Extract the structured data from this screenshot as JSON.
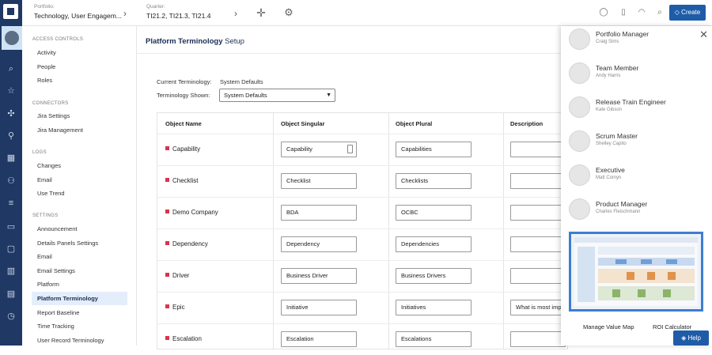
{
  "topbar": {
    "portfolio_label": "Portfolio:",
    "portfolio_value": "Technology, User Engagem...",
    "quarter_label": "Quarter:",
    "quarter_value": "TI21.2, TI21.3, TI21.4",
    "create_label": "Create"
  },
  "sidebar": {
    "sections": [
      {
        "heading": "ACCESS CONTROLS",
        "items": [
          "Activity",
          "People",
          "Roles"
        ]
      },
      {
        "heading": "CONNECTORS",
        "items": [
          "Jira Settings",
          "Jira Management"
        ]
      },
      {
        "heading": "LOGS",
        "items": [
          "Changes",
          "Email",
          "Use Trend"
        ]
      },
      {
        "heading": "SETTINGS",
        "items": [
          "Announcement",
          "Details Panels Settings",
          "Email",
          "Email Settings",
          "Platform",
          "Platform Terminology",
          "Report Baseline",
          "Time Tracking",
          "User Record Terminology"
        ]
      }
    ],
    "active": "Platform Terminology"
  },
  "page": {
    "title_bold": "Platform Terminology",
    "title_rest": " Setup",
    "current_label": "Current Terminology:",
    "current_value": "System Defaults",
    "shown_label": "Terminology Shown:",
    "shown_value": "System Defaults"
  },
  "table": {
    "headers": [
      "Object Name",
      "Object Singular",
      "Object Plural",
      "Description"
    ],
    "rows": [
      {
        "name": "Capability",
        "singular": "Capability",
        "plural": "Capabilities",
        "description": ""
      },
      {
        "name": "Checklist",
        "singular": "Checklist",
        "plural": "Checklists",
        "description": ""
      },
      {
        "name": "Demo Company",
        "singular": "BDA",
        "plural": "OCBC",
        "description": ""
      },
      {
        "name": "Dependency",
        "singular": "Dependency",
        "plural": "Dependencies",
        "description": ""
      },
      {
        "name": "Driver",
        "singular": "Business Driver",
        "plural": "Business Drivers",
        "description": ""
      },
      {
        "name": "Epic",
        "singular": "Initiative",
        "plural": "Initiatives",
        "description": "What is most imp"
      },
      {
        "name": "Escalation",
        "singular": "Escalation",
        "plural": "Escalations",
        "description": ""
      }
    ]
  },
  "panel": {
    "people": [
      {
        "role": "Portfolio Manager",
        "name": "Craig Sims"
      },
      {
        "role": "Team Member",
        "name": "Andy Harris"
      },
      {
        "role": "Release Train Engineer",
        "name": "Kate Gibson"
      },
      {
        "role": "Scrum Master",
        "name": "Shelley Capito"
      },
      {
        "role": "Executive",
        "name": "Matt Comyn"
      },
      {
        "role": "Product Manager",
        "name": "Charles Fleischmann"
      }
    ],
    "manage_label": "Manage Value Map",
    "roi_label": "ROI Calculator"
  },
  "help_label": "Help",
  "colors": {
    "rail": "#1f3864",
    "accent": "#1f5ca8",
    "marker": "#d9344a"
  }
}
